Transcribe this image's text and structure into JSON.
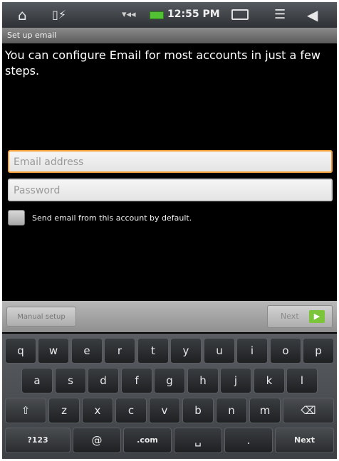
{
  "status_bar": {
    "time": "12:55 PM",
    "icons": [
      "home-icon",
      "usb-icon",
      "signal-icon",
      "battery-icon",
      "keyboard-icon",
      "menu-icon",
      "back-icon"
    ]
  },
  "title_bar": {
    "title": "Set up email"
  },
  "intro_text": "You can configure Email for most accounts in just a few steps.",
  "form": {
    "email_placeholder": "Email address",
    "password_placeholder": "Password",
    "default_checkbox_label": "Send email from this account by default."
  },
  "actions": {
    "manual_setup": "Manual setup",
    "next": "Next"
  },
  "keyboard": {
    "row1": [
      "q",
      "w",
      "e",
      "r",
      "t",
      "y",
      "u",
      "i",
      "o",
      "p"
    ],
    "row2": [
      "a",
      "s",
      "d",
      "f",
      "g",
      "h",
      "j",
      "k",
      "l"
    ],
    "row3": [
      "⇧",
      "z",
      "x",
      "c",
      "v",
      "b",
      "n",
      "m",
      "⌫"
    ],
    "row4": [
      "?123",
      "@",
      ".com",
      "␣",
      ".",
      "Next"
    ]
  }
}
